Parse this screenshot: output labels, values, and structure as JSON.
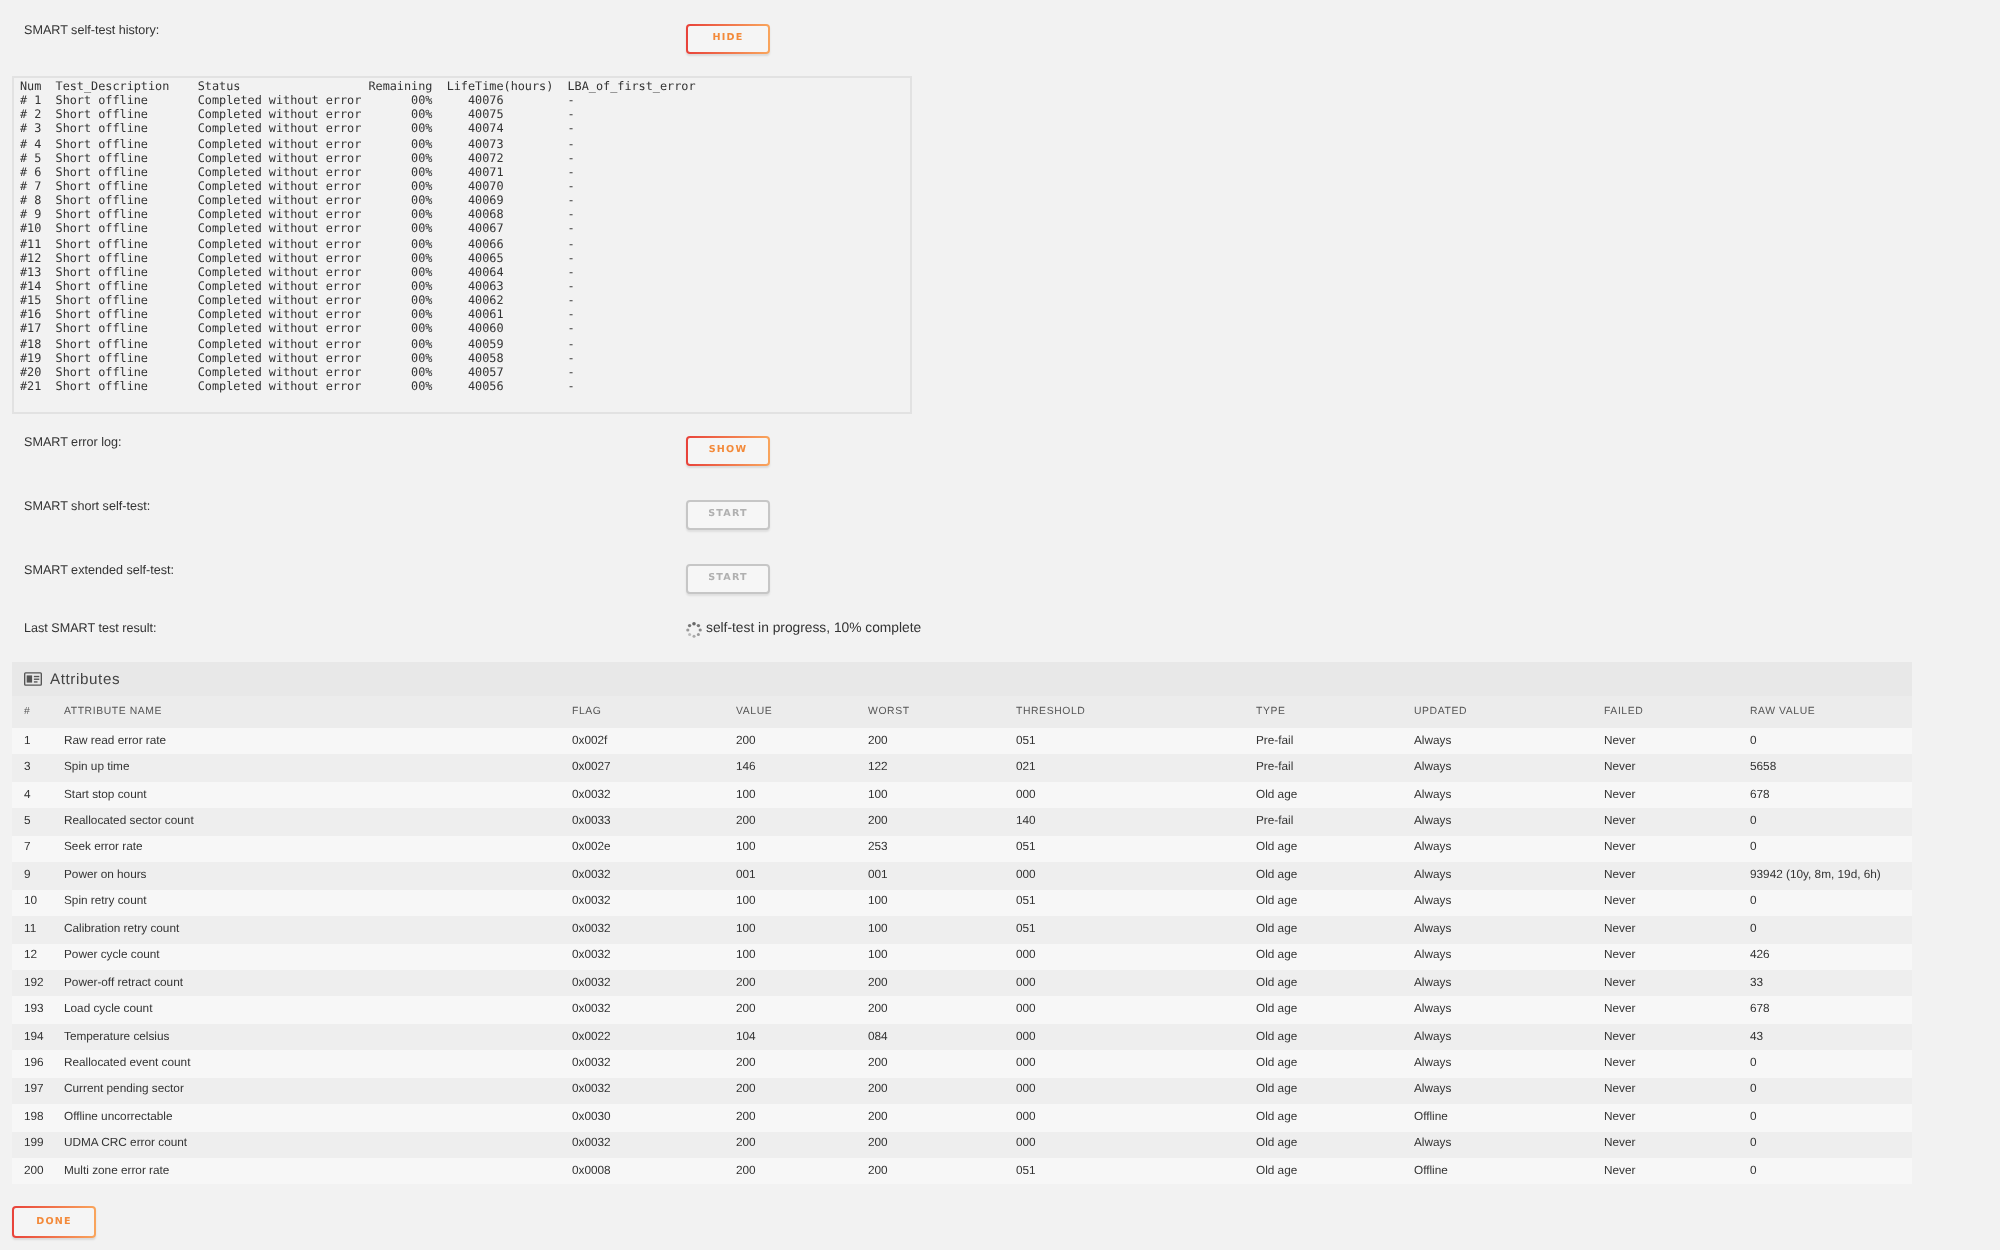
{
  "self_test_history": {
    "label": "SMART self-test history:",
    "button": {
      "label": "HIDE",
      "disabled": false
    },
    "columns": [
      "Num",
      "Test_Description",
      "Status",
      "Remaining",
      "LifeTime(hours)",
      "LBA_of_first_error"
    ],
    "rows": [
      [
        "# 1",
        "Short offline",
        "Completed without error",
        "00%",
        "40076",
        "-"
      ],
      [
        "# 2",
        "Short offline",
        "Completed without error",
        "00%",
        "40075",
        "-"
      ],
      [
        "# 3",
        "Short offline",
        "Completed without error",
        "00%",
        "40074",
        "-"
      ],
      [
        "# 4",
        "Short offline",
        "Completed without error",
        "00%",
        "40073",
        "-"
      ],
      [
        "# 5",
        "Short offline",
        "Completed without error",
        "00%",
        "40072",
        "-"
      ],
      [
        "# 6",
        "Short offline",
        "Completed without error",
        "00%",
        "40071",
        "-"
      ],
      [
        "# 7",
        "Short offline",
        "Completed without error",
        "00%",
        "40070",
        "-"
      ],
      [
        "# 8",
        "Short offline",
        "Completed without error",
        "00%",
        "40069",
        "-"
      ],
      [
        "# 9",
        "Short offline",
        "Completed without error",
        "00%",
        "40068",
        "-"
      ],
      [
        "#10",
        "Short offline",
        "Completed without error",
        "00%",
        "40067",
        "-"
      ],
      [
        "#11",
        "Short offline",
        "Completed without error",
        "00%",
        "40066",
        "-"
      ],
      [
        "#12",
        "Short offline",
        "Completed without error",
        "00%",
        "40065",
        "-"
      ],
      [
        "#13",
        "Short offline",
        "Completed without error",
        "00%",
        "40064",
        "-"
      ],
      [
        "#14",
        "Short offline",
        "Completed without error",
        "00%",
        "40063",
        "-"
      ],
      [
        "#15",
        "Short offline",
        "Completed without error",
        "00%",
        "40062",
        "-"
      ],
      [
        "#16",
        "Short offline",
        "Completed without error",
        "00%",
        "40061",
        "-"
      ],
      [
        "#17",
        "Short offline",
        "Completed without error",
        "00%",
        "40060",
        "-"
      ],
      [
        "#18",
        "Short offline",
        "Completed without error",
        "00%",
        "40059",
        "-"
      ],
      [
        "#19",
        "Short offline",
        "Completed without error",
        "00%",
        "40058",
        "-"
      ],
      [
        "#20",
        "Short offline",
        "Completed without error",
        "00%",
        "40057",
        "-"
      ],
      [
        "#21",
        "Short offline",
        "Completed without error",
        "00%",
        "40056",
        "-"
      ]
    ]
  },
  "controls": [
    {
      "kind": "button",
      "label": "SMART error log:",
      "button": {
        "label": "SHOW",
        "disabled": false
      }
    },
    {
      "kind": "button",
      "label": "SMART short self-test:",
      "button": {
        "label": "START",
        "disabled": true
      }
    },
    {
      "kind": "button",
      "label": "SMART extended self-test:",
      "button": {
        "label": "START",
        "disabled": true
      }
    },
    {
      "kind": "status",
      "label": "Last SMART test result:",
      "value": "self-test in progress, 10% complete",
      "busy": true
    }
  ],
  "attributes": {
    "title": "Attributes",
    "columns": [
      "#",
      "ATTRIBUTE NAME",
      "FLAG",
      "VALUE",
      "WORST",
      "THRESHOLD",
      "TYPE",
      "UPDATED",
      "FAILED",
      "RAW VALUE"
    ],
    "rows": [
      [
        "1",
        "Raw read error rate",
        "0x002f",
        "200",
        "200",
        "051",
        "Pre-fail",
        "Always",
        "Never",
        "0"
      ],
      [
        "3",
        "Spin up time",
        "0x0027",
        "146",
        "122",
        "021",
        "Pre-fail",
        "Always",
        "Never",
        "5658"
      ],
      [
        "4",
        "Start stop count",
        "0x0032",
        "100",
        "100",
        "000",
        "Old age",
        "Always",
        "Never",
        "678"
      ],
      [
        "5",
        "Reallocated sector count",
        "0x0033",
        "200",
        "200",
        "140",
        "Pre-fail",
        "Always",
        "Never",
        "0"
      ],
      [
        "7",
        "Seek error rate",
        "0x002e",
        "100",
        "253",
        "051",
        "Old age",
        "Always",
        "Never",
        "0"
      ],
      [
        "9",
        "Power on hours",
        "0x0032",
        "001",
        "001",
        "000",
        "Old age",
        "Always",
        "Never",
        "93942 (10y, 8m, 19d, 6h)"
      ],
      [
        "10",
        "Spin retry count",
        "0x0032",
        "100",
        "100",
        "051",
        "Old age",
        "Always",
        "Never",
        "0"
      ],
      [
        "11",
        "Calibration retry count",
        "0x0032",
        "100",
        "100",
        "051",
        "Old age",
        "Always",
        "Never",
        "0"
      ],
      [
        "12",
        "Power cycle count",
        "0x0032",
        "100",
        "100",
        "000",
        "Old age",
        "Always",
        "Never",
        "426"
      ],
      [
        "192",
        "Power-off retract count",
        "0x0032",
        "200",
        "200",
        "000",
        "Old age",
        "Always",
        "Never",
        "33"
      ],
      [
        "193",
        "Load cycle count",
        "0x0032",
        "200",
        "200",
        "000",
        "Old age",
        "Always",
        "Never",
        "678"
      ],
      [
        "194",
        "Temperature celsius",
        "0x0022",
        "104",
        "084",
        "000",
        "Old age",
        "Always",
        "Never",
        "43"
      ],
      [
        "196",
        "Reallocated event count",
        "0x0032",
        "200",
        "200",
        "000",
        "Old age",
        "Always",
        "Never",
        "0"
      ],
      [
        "197",
        "Current pending sector",
        "0x0032",
        "200",
        "200",
        "000",
        "Old age",
        "Always",
        "Never",
        "0"
      ],
      [
        "198",
        "Offline uncorrectable",
        "0x0030",
        "200",
        "200",
        "000",
        "Old age",
        "Offline",
        "Never",
        "0"
      ],
      [
        "199",
        "UDMA CRC error count",
        "0x0032",
        "200",
        "200",
        "000",
        "Old age",
        "Always",
        "Never",
        "0"
      ],
      [
        "200",
        "Multi zone error rate",
        "0x0008",
        "200",
        "200",
        "051",
        "Old age",
        "Offline",
        "Never",
        "0"
      ]
    ]
  },
  "done_button": {
    "label": "DONE",
    "disabled": false
  }
}
